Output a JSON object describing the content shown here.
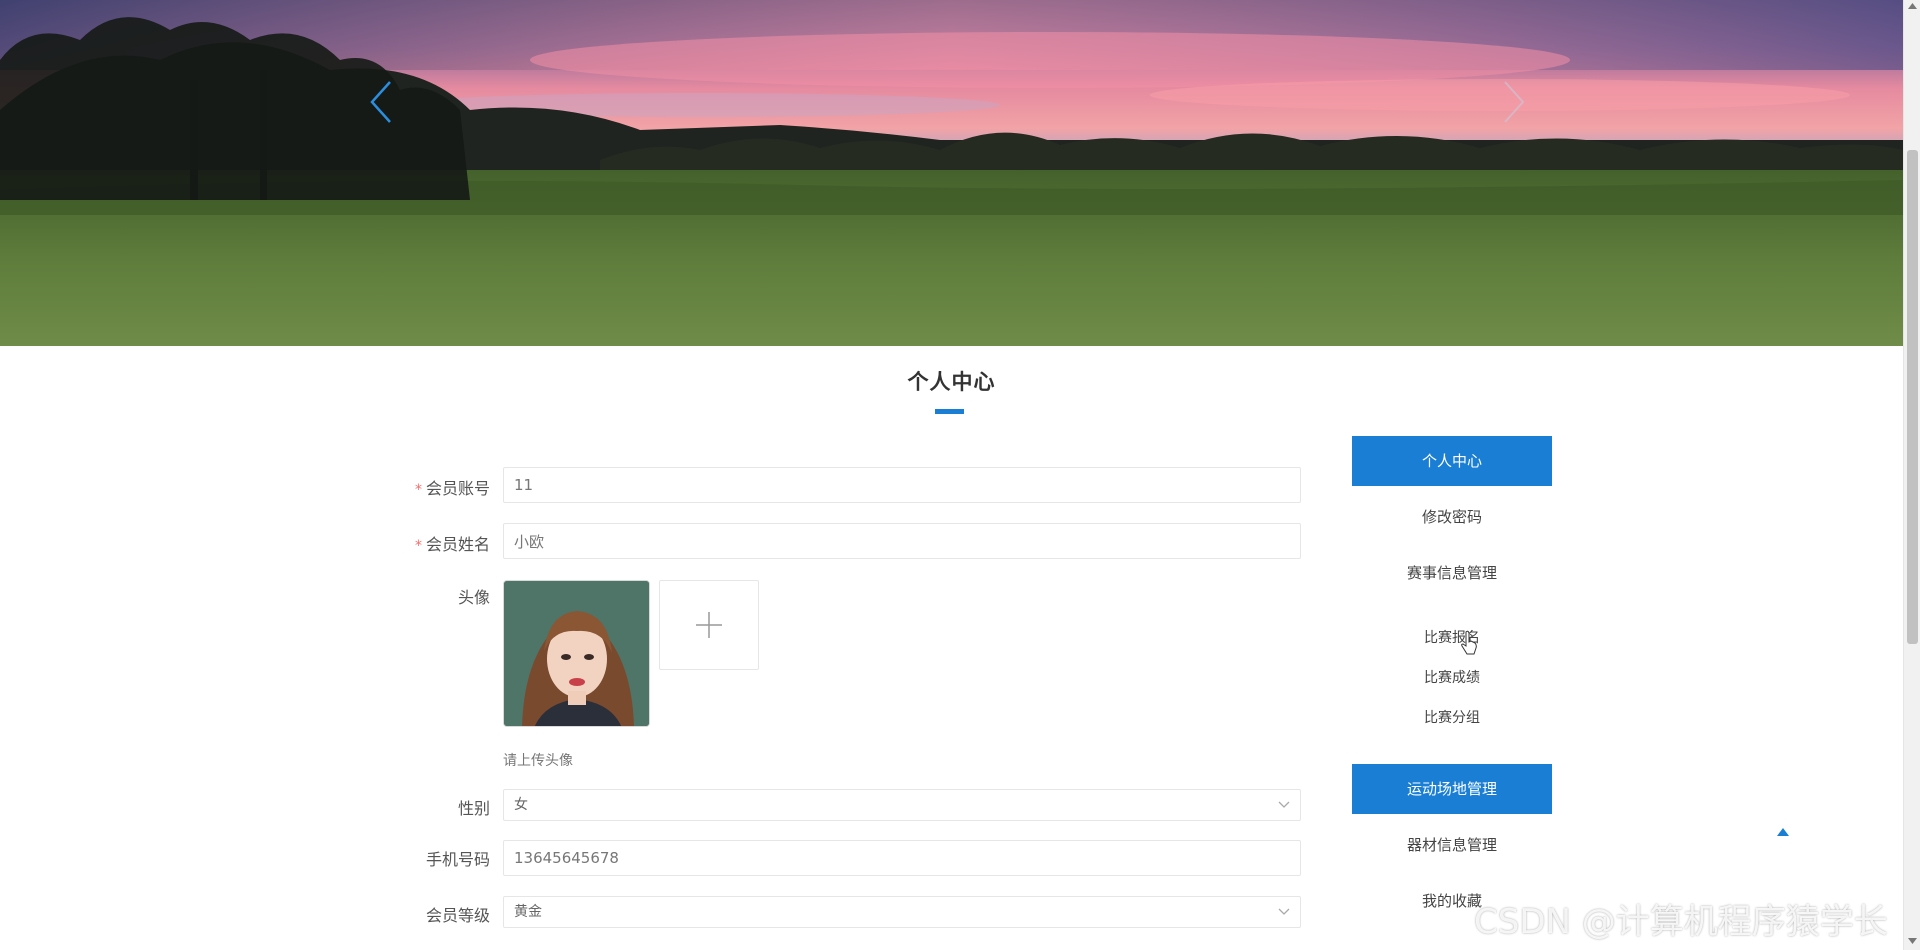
{
  "banner": {
    "prev_icon": "chevron-left-icon",
    "next_icon": "chevron-right-icon"
  },
  "page": {
    "title": "个人中心"
  },
  "form": {
    "account": {
      "label": "会员账号",
      "value": "11",
      "required": true
    },
    "name": {
      "label": "会员姓名",
      "value": "小欧",
      "required": true
    },
    "avatar": {
      "label": "头像",
      "hint": "请上传头像",
      "upload_icon": "plus-icon"
    },
    "gender": {
      "label": "性别",
      "value": "女"
    },
    "phone": {
      "label": "手机号码",
      "value": "13645645678"
    },
    "level": {
      "label": "会员等级",
      "value": "黄金"
    }
  },
  "side_menu": {
    "items": [
      {
        "label": "个人中心",
        "active": true
      },
      {
        "label": "修改密码",
        "active": false
      },
      {
        "label": "赛事信息管理",
        "active": false
      },
      {
        "label": "比赛报名",
        "active": false
      },
      {
        "label": "比赛成绩",
        "active": false
      },
      {
        "label": "比赛分组",
        "active": false
      },
      {
        "label": "运动场地管理",
        "active": true
      },
      {
        "label": "器材信息管理",
        "active": false
      },
      {
        "label": "我的收藏",
        "active": false
      }
    ]
  },
  "watermark": "CSDN @计算机程序猿学长",
  "colors": {
    "accent": "#1a7fd4",
    "required": "#f56c6c"
  }
}
